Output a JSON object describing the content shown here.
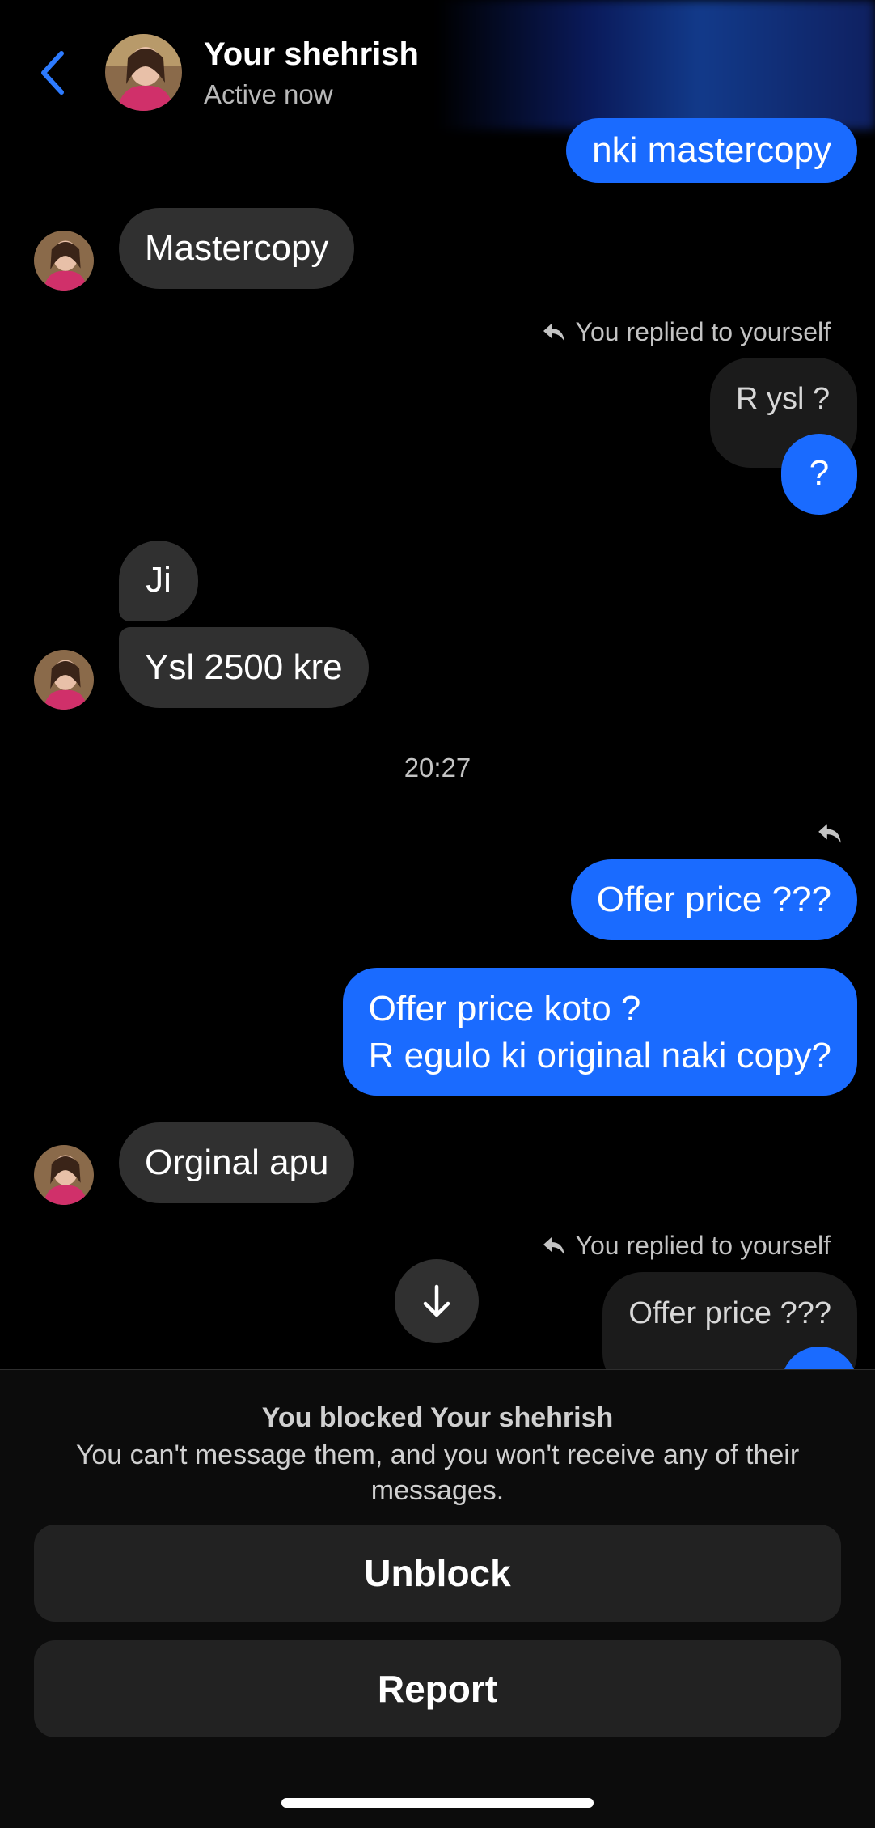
{
  "header": {
    "contact_name": "Your shehrish",
    "status": "Active now"
  },
  "messages": {
    "m0": "nki mastercopy",
    "m1": "Mastercopy",
    "reply_note_1": "You replied to yourself",
    "q1": "R ysl ?",
    "m2": "?",
    "m3": "Ji",
    "m4": "Ysl 2500 kre",
    "time": "20:27",
    "m5": "Offer price ???",
    "m6_line1": "Offer price koto ?",
    "m6_line2": "R egulo ki original naki copy?",
    "m7": "Orginal apu",
    "reply_note_2": "You replied to yourself",
    "q2": "Offer price ???"
  },
  "blocked": {
    "title": "You blocked Your shehrish",
    "description": "You can't message them, and you won't receive any of their messages.",
    "unblock_label": "Unblock",
    "report_label": "Report"
  },
  "colors": {
    "accent": "#1a6bff",
    "incoming_bubble": "#303030",
    "background": "#000000"
  },
  "icons": {
    "back": "chevron-left-icon",
    "reply": "reply-arrow-icon",
    "scroll_down": "arrow-down-icon"
  }
}
